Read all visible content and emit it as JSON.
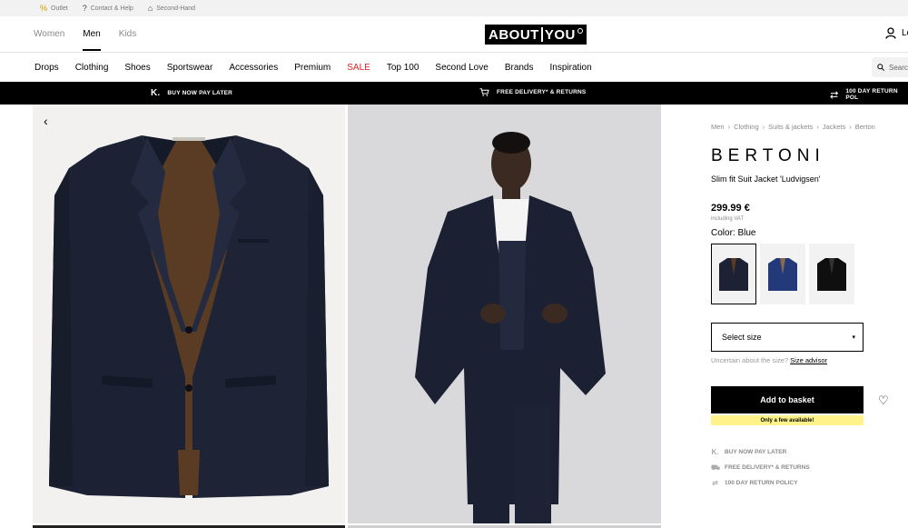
{
  "utility": {
    "outlet": "Outlet",
    "contact": "Contact & Help",
    "second_hand": "Second-Hand"
  },
  "header": {
    "gender_tabs": [
      "Women",
      "Men",
      "Kids"
    ],
    "active_gender": "Men",
    "logo_left": "ABOUT",
    "logo_right": "YOU",
    "account_label": "Lo"
  },
  "nav": {
    "items": [
      "Drops",
      "Clothing",
      "Shoes",
      "Sportswear",
      "Accessories",
      "Premium",
      "SALE",
      "Top 100",
      "Second Love",
      "Brands",
      "Inspiration"
    ],
    "search_placeholder": "Searc"
  },
  "promo": {
    "k_icon": "K.",
    "buy_now": "BUY NOW PAY LATER",
    "delivery": "FREE DELIVERY* & RETURNS",
    "return_policy": "100 DAY RETURN POL"
  },
  "product": {
    "breadcrumb": [
      "Men",
      "Clothing",
      "Suits & jackets",
      "Jackets",
      "Berton"
    ],
    "brand": "BERTONI",
    "name": "Slim fit Suit Jacket 'Ludvigsen'",
    "price": "299.99 €",
    "vat": "including VAT",
    "color_label": "Color: Blue",
    "size_select": "Select size",
    "size_question": "Uncertain about the size?",
    "size_advisor": "Size advisor",
    "add_to_basket": "Add to basket",
    "stock_notice": "Only a few available!",
    "perks": [
      "BUY NOW PAY LATER",
      "FREE DELIVERY* & RETURNS",
      "100 DAY RETURN POLICY"
    ]
  },
  "colors": {
    "navy": "#1c2233",
    "royal": "#233a7a",
    "black": "#0f0f0f",
    "sale": "#e02020",
    "stock_bg": "#fff38a"
  }
}
